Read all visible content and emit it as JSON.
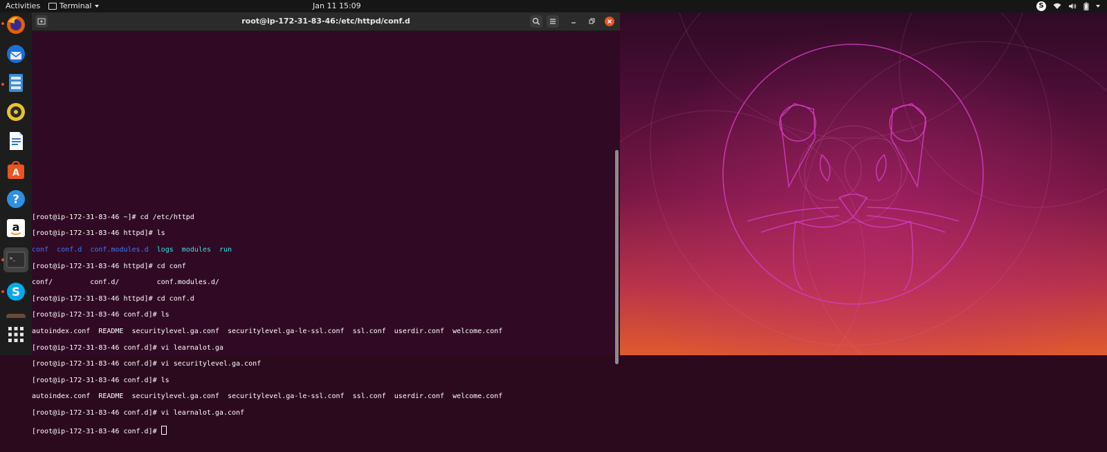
{
  "topbar": {
    "activities": "Activities",
    "app_name": "Terminal",
    "clock": "Jan 11  15:09",
    "tray_skype": "S"
  },
  "dock": {
    "items": [
      {
        "name": "firefox-icon",
        "running": true
      },
      {
        "name": "thunderbird-icon",
        "running": false
      },
      {
        "name": "files-icon",
        "running": true
      },
      {
        "name": "rhythmbox-icon",
        "running": false
      },
      {
        "name": "libreoffice-writer-icon",
        "running": false
      },
      {
        "name": "ubuntu-software-icon",
        "running": false,
        "glyph": "A"
      },
      {
        "name": "help-icon",
        "running": false,
        "glyph": "?"
      },
      {
        "name": "amazon-icon",
        "running": false,
        "glyph": "a"
      },
      {
        "name": "terminal-icon",
        "running": true,
        "active": true,
        "glyph": ">_"
      },
      {
        "name": "skype-icon",
        "running": true,
        "glyph": "S"
      },
      {
        "name": "show-applications-icon",
        "running": false
      }
    ]
  },
  "window": {
    "title": "root@ip-172-31-83-46:/etc/httpd/conf.d",
    "icons": [
      "new-tab-icon",
      "search-icon",
      "hamburger-menu-icon",
      "minimize-icon",
      "restore-icon",
      "close-icon"
    ]
  },
  "terminal": {
    "lines": [
      "[root@ip-172-31-83-46 ~]# cd /etc/httpd",
      "[root@ip-172-31-83-46 httpd]# ls",
      "",
      "[root@ip-172-31-83-46 httpd]# cd conf",
      "conf/         conf.d/         conf.modules.d/",
      "[root@ip-172-31-83-46 httpd]# cd conf.d",
      "[root@ip-172-31-83-46 conf.d]# ls",
      "autoindex.conf  README  securitylevel.ga.conf  securitylevel.ga-le-ssl.conf  ssl.conf  userdir.conf  welcome.conf",
      "[root@ip-172-31-83-46 conf.d]# vi learnalot.ga",
      "[root@ip-172-31-83-46 conf.d]# vi securitylevel.ga.conf",
      "[root@ip-172-31-83-46 conf.d]# ls",
      "autoindex.conf  README  securitylevel.ga.conf  securitylevel.ga-le-ssl.conf  ssl.conf  userdir.conf  welcome.conf",
      "[root@ip-172-31-83-46 conf.d]# vi learnalot.ga.conf",
      "[root@ip-172-31-83-46 conf.d]# "
    ],
    "ls_output": [
      {
        "text": "conf",
        "color": "#3b78ff"
      },
      {
        "text": "conf.d",
        "color": "#3b78ff"
      },
      {
        "text": "conf.modules.d",
        "color": "#3b78ff"
      },
      {
        "text": "logs",
        "color": "#34e2e2"
      },
      {
        "text": "modules",
        "color": "#34e2e2"
      },
      {
        "text": "run",
        "color": "#34e2e2"
      }
    ]
  },
  "colors": {
    "terminal_bg": "#300a24",
    "accent": "#e95420",
    "dir_blue": "#3b78ff",
    "link_cyan": "#34e2e2"
  }
}
